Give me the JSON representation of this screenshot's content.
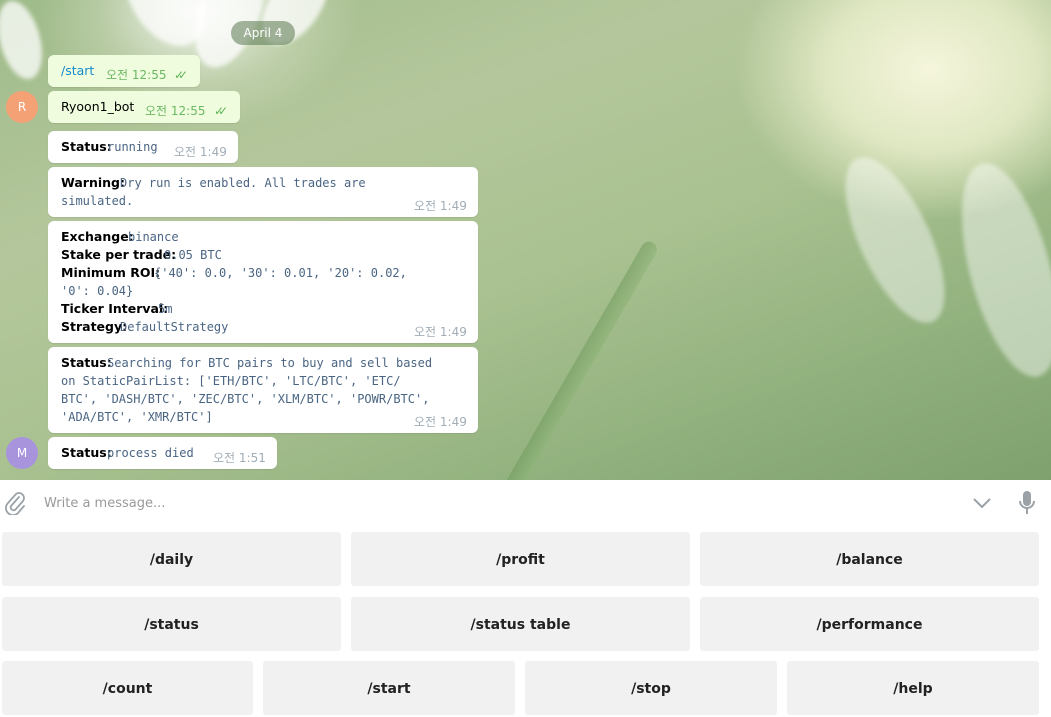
{
  "date_divider": "April 4",
  "avatars": {
    "bot": "R",
    "user": "M",
    "bot_color": "#f4a176",
    "user_color": "#a894dd"
  },
  "messages": {
    "m1": {
      "text": "/start",
      "time": "오전 12:55",
      "status": "✓✓"
    },
    "m2": {
      "text": "Ryoon1_bot",
      "time": "오전 12:55",
      "status": "✓✓"
    },
    "m3": {
      "label": "Status:",
      "value": "running",
      "time": "오전 1:49"
    },
    "m4": {
      "label": "Warning:",
      "value_line1": "Dry run is enabled. All trades are",
      "value_line2": "simulated.",
      "time": "오전 1:49"
    },
    "m5": {
      "exchange_label": "Exchange:",
      "exchange_value": "binance",
      "stake_label": "Stake per trade:",
      "stake_value": "0.05 BTC",
      "roi_label": "Minimum ROI:",
      "roi_value_line1": "{'40': 0.0, '30': 0.01, '20': 0.02,",
      "roi_value_line2": "'0': 0.04}",
      "ticker_label": "Ticker Interval:",
      "ticker_value": "5m",
      "strategy_label": "Strategy:",
      "strategy_value": "DefaultStrategy",
      "time": "오전 1:49"
    },
    "m6": {
      "label": "Status:",
      "value_line1": "Searching for BTC pairs to buy and sell based",
      "value_line2": "on StaticPairList: ['ETH/BTC', 'LTC/BTC', 'ETC/",
      "value_line3": "BTC', 'DASH/BTC', 'ZEC/BTC', 'XLM/BTC', 'POWR/BTC',",
      "value_line4": "'ADA/BTC', 'XMR/BTC']",
      "time": "오전 1:49"
    },
    "m7": {
      "label": "Status:",
      "value": "process died",
      "time": "오전 1:51"
    }
  },
  "composer": {
    "placeholder": "Write a message..."
  },
  "keyboard": {
    "row1": [
      "/daily",
      "/profit",
      "/balance"
    ],
    "row2": [
      "/status",
      "/status table",
      "/performance"
    ],
    "row3": [
      "/count",
      "/start",
      "/stop",
      "/help"
    ]
  },
  "icons": {
    "attach": "paperclip-icon",
    "scroll": "chevron-down-icon",
    "mic": "microphone-icon"
  }
}
